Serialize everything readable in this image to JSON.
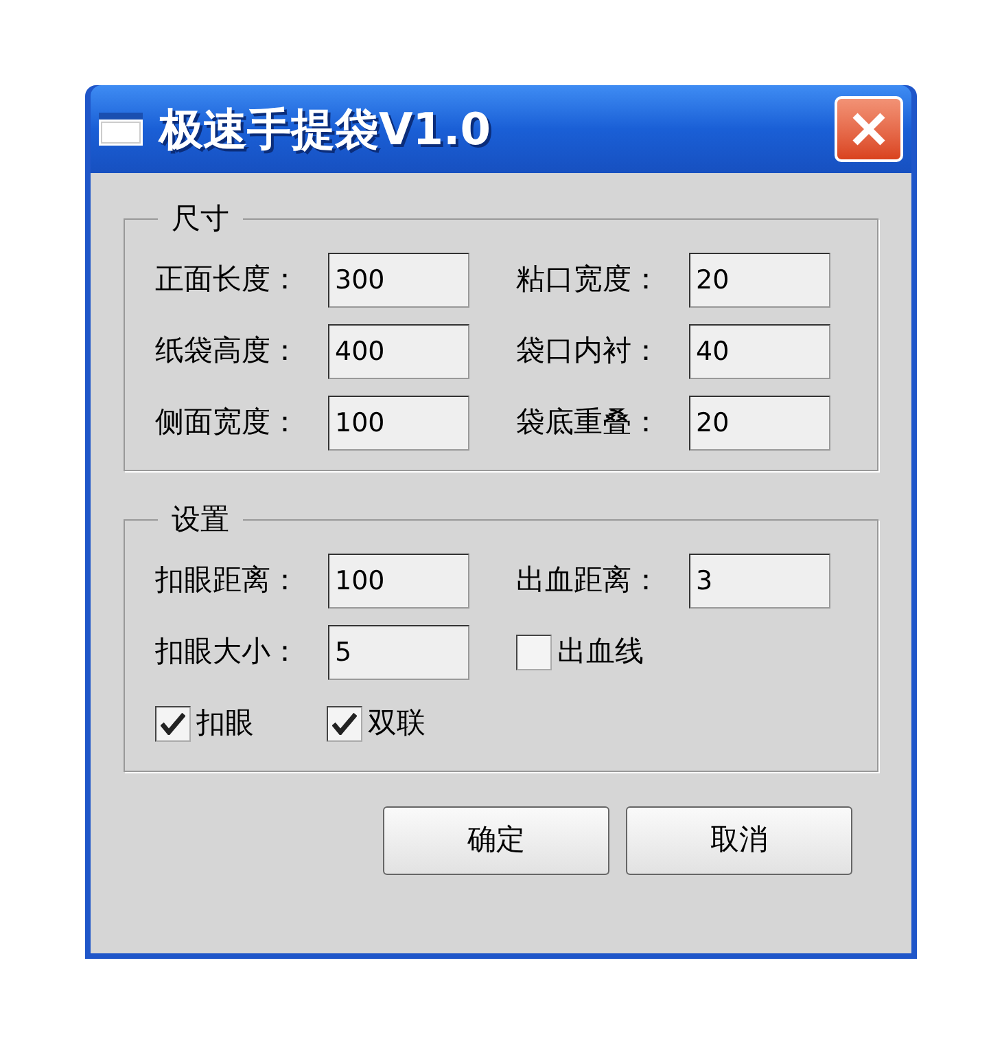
{
  "window": {
    "title": "极速手提袋V1.0"
  },
  "groups": [
    {
      "title": "尺寸",
      "rows": [
        [
          {
            "kind": "field",
            "label": "正面长度：",
            "value": "300"
          },
          {
            "kind": "field",
            "label": "粘口宽度：",
            "value": "20"
          }
        ],
        [
          {
            "kind": "field",
            "label": "纸袋高度：",
            "value": "400"
          },
          {
            "kind": "field",
            "label": "袋口内衬：",
            "value": "40"
          }
        ],
        [
          {
            "kind": "field",
            "label": "侧面宽度：",
            "value": "100"
          },
          {
            "kind": "field",
            "label": "袋底重叠：",
            "value": "20"
          }
        ]
      ]
    },
    {
      "title": "设置",
      "rows": [
        [
          {
            "kind": "field",
            "label": "扣眼距离：",
            "value": "100"
          },
          {
            "kind": "field",
            "label": "出血距离：",
            "value": "3"
          }
        ],
        [
          {
            "kind": "field",
            "label": "扣眼大小：",
            "value": "5"
          },
          {
            "kind": "checkbox",
            "label": "出血线",
            "checked": false
          }
        ],
        [
          {
            "kind": "checkbox",
            "label": "扣眼",
            "checked": true
          },
          {
            "kind": "checkbox",
            "label": "双联",
            "checked": true
          }
        ]
      ]
    }
  ],
  "buttons": [
    "确定",
    "取消"
  ]
}
